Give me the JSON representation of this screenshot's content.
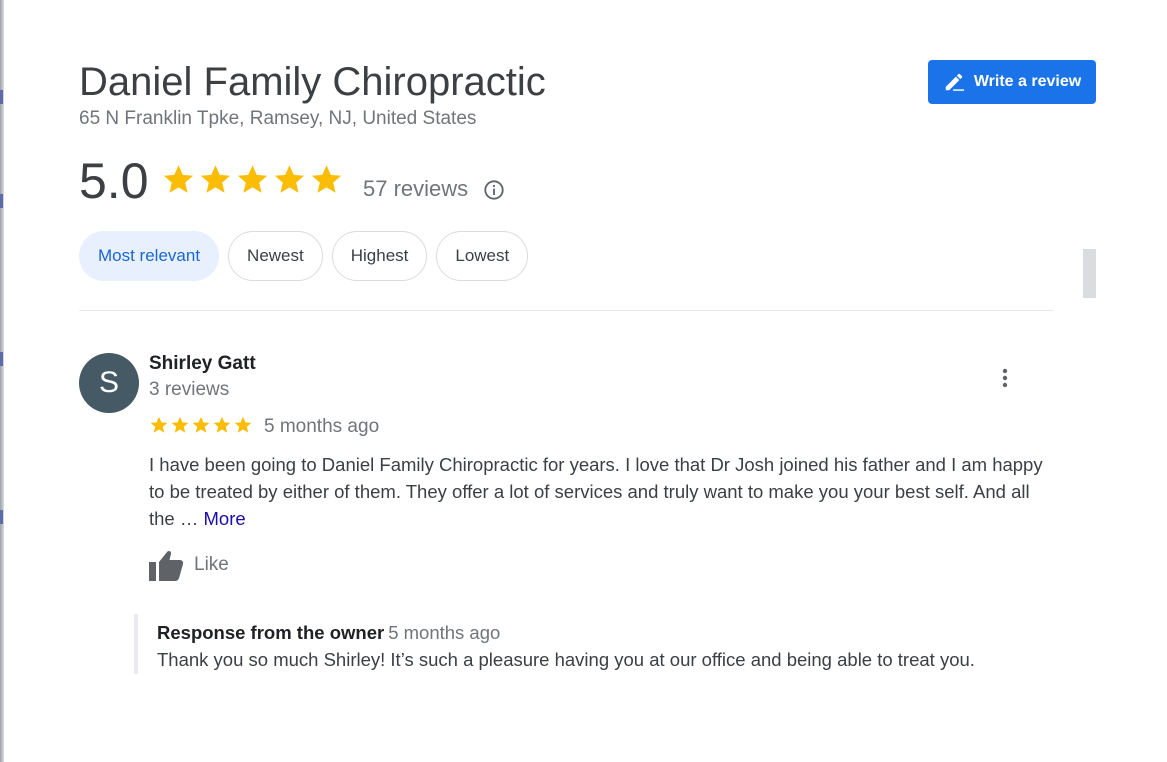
{
  "business": {
    "name": "Daniel Family Chiropractic",
    "address": "65 N Franklin Tpke, Ramsey, NJ, United States"
  },
  "write_review": {
    "label": "Write a review",
    "icon": "pencil-icon"
  },
  "rating": {
    "value": "5.0",
    "stars_filled": 5,
    "stars_total": 5,
    "review_count": "57 reviews",
    "info_icon": "info-icon"
  },
  "filters": {
    "selected": "Most relevant",
    "items": [
      "Most relevant",
      "Newest",
      "Highest",
      "Lowest"
    ]
  },
  "review": {
    "avatar_letter": "S",
    "reviewer_name": "Shirley Gatt",
    "reviewer_meta": "3 reviews",
    "stars": 5,
    "date": "5 months ago",
    "text": "I have been going to Daniel Family Chiropractic for years.  I love that Dr Josh joined his father and I am happy to be treated by either of them. They offer a lot of services and truly want to make you your best self. And all the …",
    "more_label": "More",
    "like_label": "Like",
    "response": {
      "title": "Response from the owner",
      "date": "5 months ago",
      "text": "Thank you so much Shirley! It’s such a pleasure having you at our office and being able to treat you."
    }
  },
  "colors": {
    "accent": "#1a73e8",
    "star": "#fbbc04",
    "chip_selected_bg": "#e8f0fe",
    "chip_selected_text": "#1967d2",
    "avatar_bg": "#455a64",
    "link": "#1a0dab"
  }
}
